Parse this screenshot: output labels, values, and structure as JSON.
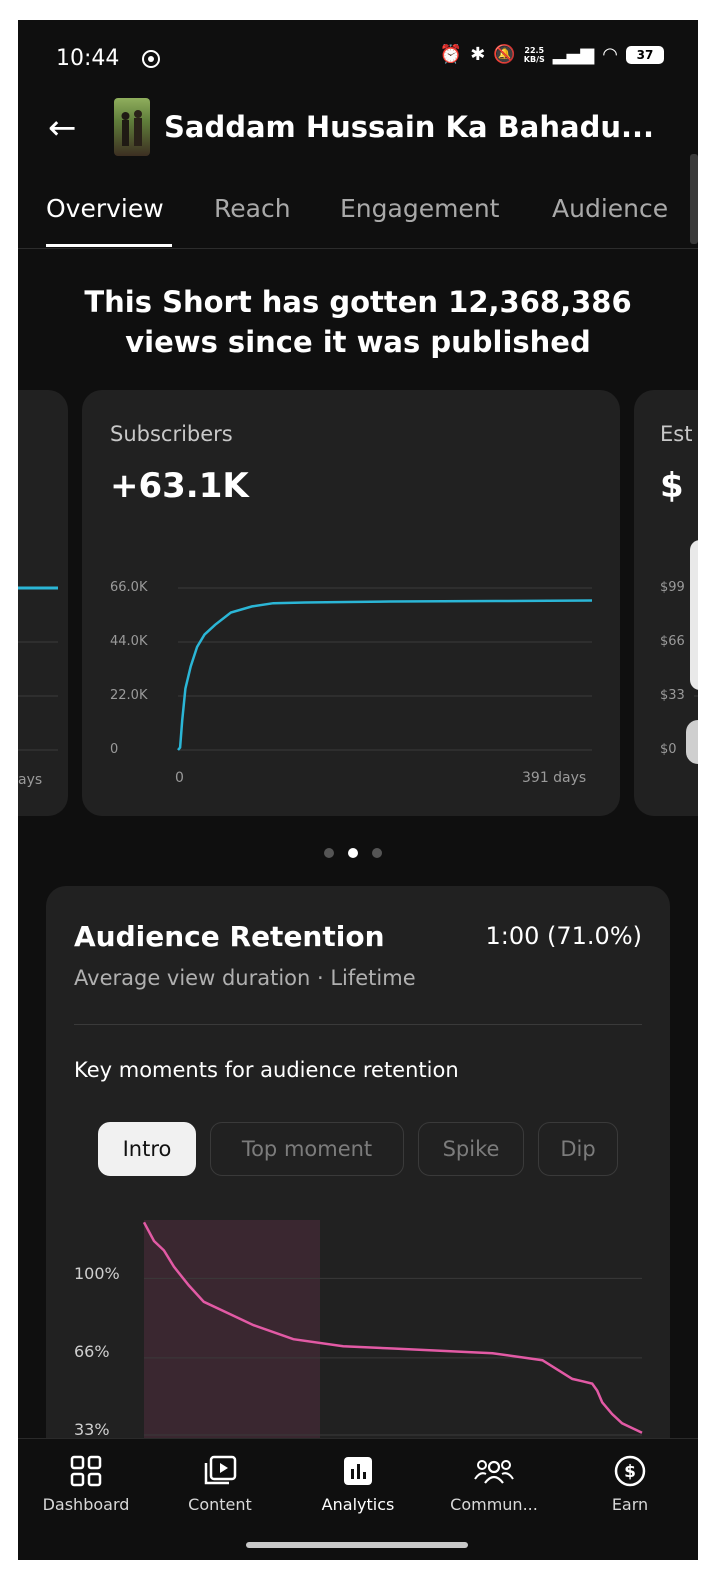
{
  "status": {
    "time": "10:44",
    "speed_top": "22.5",
    "speed_bottom": "KB/S",
    "battery": "37"
  },
  "header": {
    "title": "Saddam Hussain Ka Bahadu..."
  },
  "tabs": [
    "Overview",
    "Reach",
    "Engagement",
    "Audience"
  ],
  "headline": "This Short has gotten 12,368,386 views since it was published",
  "subscribers_card": {
    "label": "Subscribers",
    "value": "+63.1K",
    "chart_data": {
      "type": "line",
      "xlabel": "",
      "ylabel": "",
      "x_ticks": [
        "0",
        "391 days"
      ],
      "y_ticks": [
        "0",
        "22.0K",
        "44.0K",
        "66.0K"
      ],
      "xlim": [
        0,
        391
      ],
      "ylim": [
        0,
        66000
      ],
      "color": "#2bb6d6",
      "series": [
        {
          "x": [
            0,
            2,
            4,
            7,
            12,
            18,
            25,
            35,
            50,
            70,
            90,
            120,
            160,
            200,
            250,
            300,
            350,
            391
          ],
          "y": [
            0,
            1000,
            12000,
            25000,
            34000,
            42000,
            47000,
            51000,
            56000,
            58500,
            59800,
            60100,
            60300,
            60500,
            60600,
            60700,
            60800,
            60900
          ]
        }
      ]
    }
  },
  "left_card": {
    "x_tick": "ays"
  },
  "right_card": {
    "label": "Est",
    "value": "$",
    "y_ticks": [
      "$0",
      "$33",
      "$66",
      "$99"
    ]
  },
  "retention": {
    "title": "Audience Retention",
    "value": "1:00 (71.0%)",
    "subtitle": "Average view duration · Lifetime",
    "key_label": "Key moments for audience retention",
    "chips": [
      "Intro",
      "Top moment",
      "Spike",
      "Dip"
    ],
    "chart_data": {
      "type": "line",
      "y_ticks": [
        "33%",
        "66%",
        "100%"
      ],
      "ylim": [
        30,
        125
      ],
      "color": "#e25aa5",
      "series": [
        {
          "x": [
            0,
            2,
            4,
            6,
            9,
            12,
            17,
            22,
            30,
            40,
            50,
            60,
            70,
            80,
            86,
            88,
            90,
            91,
            92,
            94,
            96,
            98,
            100
          ],
          "y": [
            124,
            116,
            112,
            105,
            97,
            90,
            85,
            80,
            74,
            71,
            70,
            69,
            68,
            65,
            57,
            56,
            55,
            52,
            47,
            42,
            38,
            36,
            34
          ]
        }
      ]
    }
  },
  "bottom_nav": [
    {
      "label": "Dashboard",
      "icon": "dashboard-icon"
    },
    {
      "label": "Content",
      "icon": "content-icon"
    },
    {
      "label": "Analytics",
      "icon": "analytics-icon"
    },
    {
      "label": "Commun...",
      "icon": "community-icon"
    },
    {
      "label": "Earn",
      "icon": "earn-icon"
    }
  ]
}
